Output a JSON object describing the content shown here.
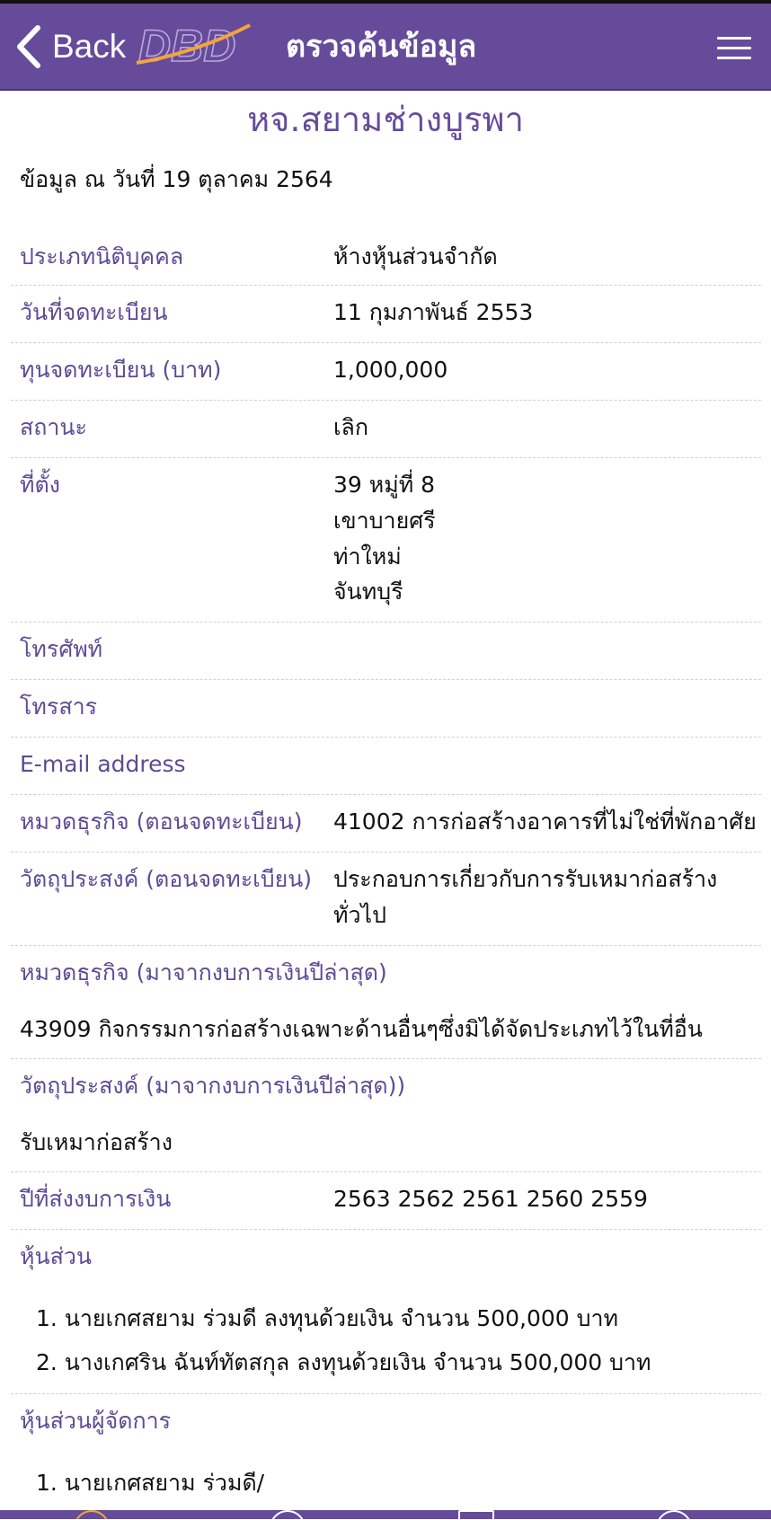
{
  "header": {
    "back_label": "Back",
    "logo_text": "DBD",
    "title": "ตรวจค้นข้อมูล"
  },
  "company_name": "หจ.สยามช่างบูรพา",
  "as_of": "ข้อมูล ณ วันที่ 19 ตุลาคม 2564",
  "fields": {
    "type": {
      "label": "ประเภทนิติบุคคล",
      "value": "ห้างหุ้นส่วนจำกัด"
    },
    "reg_date": {
      "label": "วันที่จดทะเบียน",
      "value": "11 กุมภาพันธ์ 2553"
    },
    "capital": {
      "label": "ทุนจดทะเบียน (บาท)",
      "value": "1,000,000"
    },
    "status": {
      "label": "สถานะ",
      "value": "เลิก"
    },
    "address": {
      "label": "ที่ตั้ง",
      "lines": [
        "39 หมู่ที่ 8",
        "เขาบายศรี",
        "ท่าใหม่",
        "จันทบุรี"
      ]
    },
    "phone": {
      "label": "โทรศัพท์",
      "value": ""
    },
    "fax": {
      "label": "โทรสาร",
      "value": ""
    },
    "email": {
      "label": "E-mail address",
      "value": ""
    },
    "biz_reg": {
      "label": "หมวดธุรกิจ (ตอนจดทะเบียน)",
      "value": "41002 การก่อสร้างอาคารที่ไม่ใช่ที่พักอาศัย"
    },
    "obj_reg": {
      "label": "วัตถุประสงค์ (ตอนจดทะเบียน)",
      "lines": [
        "ประกอบการเกี่ยวกับการรับเหมาก่อสร้าง",
        "ทั่วไป"
      ]
    },
    "biz_latest": {
      "label": "หมวดธุรกิจ (มาจากงบการเงินปีล่าสุด)",
      "value": "43909 กิจกรรมการก่อสร้างเฉพาะด้านอื่นๆซึ่งมิได้จัดประเภทไว้ในที่อื่น"
    },
    "obj_latest": {
      "label": "วัตถุประสงค์ (มาจากงบการเงินปีล่าสุด))",
      "value": "รับเหมาก่อสร้าง"
    },
    "fin_years": {
      "label": "ปีที่ส่งงบการเงิน",
      "value": "2563 2562 2561 2560 2559"
    },
    "partners": {
      "label": "หุ้นส่วน",
      "items": [
        "1. นายเกศสยาม ร่วมดี ลงทุนด้วยเงิน จำนวน 500,000 บาท",
        "2. นางเกศริน ฉันท์ทัตสกุล ลงทุนด้วยเงิน จำนวน 500,000 บาท"
      ]
    },
    "managers": {
      "label": "หุ้นส่วนผู้จัดการ",
      "items": [
        "1. นายเกศสยาม ร่วมดี/"
      ]
    }
  },
  "colors": {
    "brand": "#664b9b",
    "label": "#5e4b95",
    "logo_accent": "#f2a53a"
  }
}
